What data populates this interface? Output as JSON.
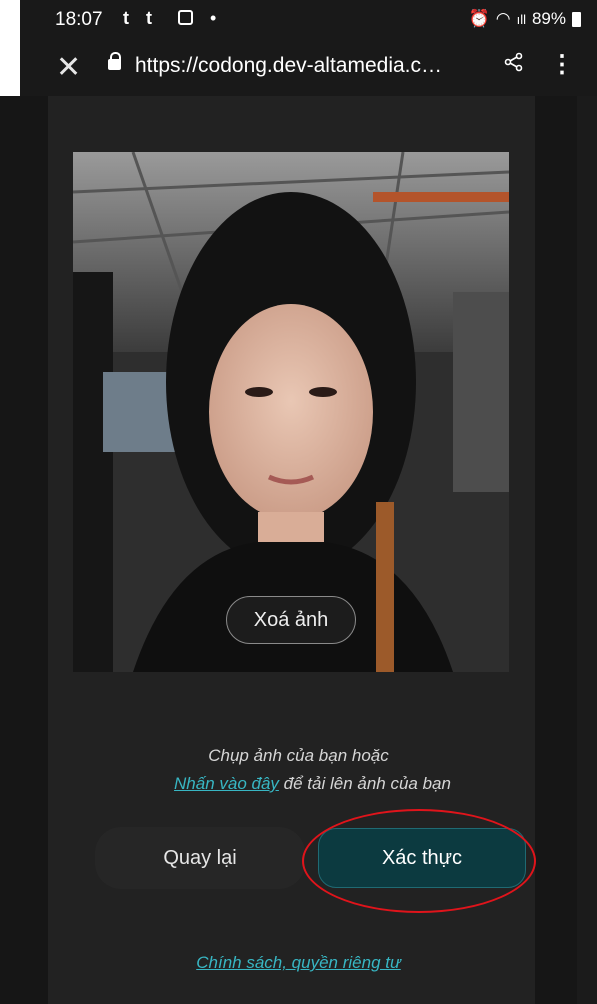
{
  "status_bar": {
    "time": "18:07",
    "notification_icons": "t t",
    "notification_app_icon": "shopee-icon",
    "dot": "•",
    "alarm_icon": "alarm-icon",
    "wifi_icon": "wifi-icon",
    "signal_icon": "signal-icon",
    "battery": "89%"
  },
  "browser": {
    "close_icon": "close-icon",
    "lock_icon": "lock-icon",
    "url": "https://codong.dev-altamedia.c…",
    "share_icon": "share-icon",
    "menu_icon": "more-vert-icon"
  },
  "photo": {
    "delete_label": "Xoá ảnh"
  },
  "instruction": {
    "line1": "Chụp ảnh của bạn hoặc",
    "link": "Nhấn vào đây",
    "line2_rest": " để tải lên ảnh của bạn"
  },
  "actions": {
    "back_label": "Quay lại",
    "confirm_label": "Xác thực"
  },
  "footer": {
    "policy_link": "Chính sách, quyền riêng tư"
  },
  "colors": {
    "accent": "#38b6c3",
    "confirm_bg": "#0c3a40",
    "annotation": "#e0141b"
  }
}
